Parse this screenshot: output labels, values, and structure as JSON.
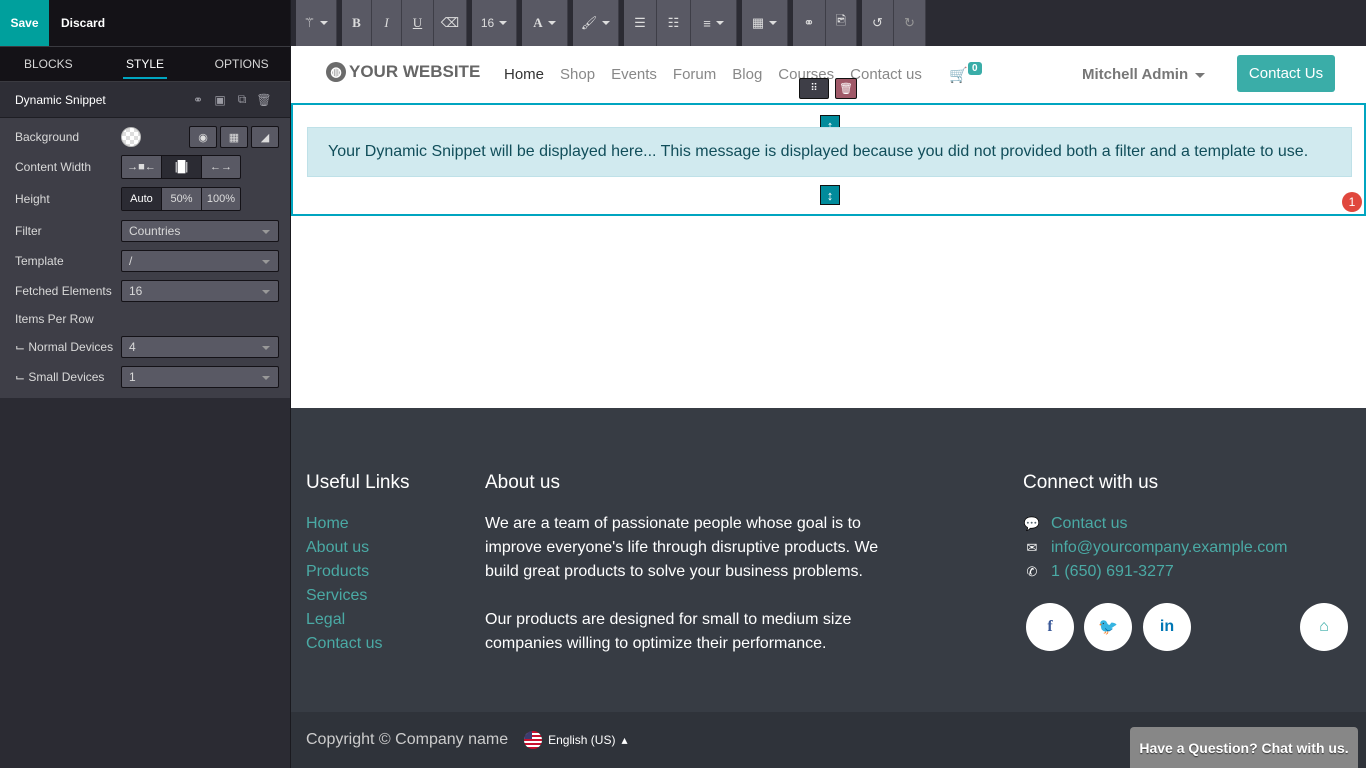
{
  "editor": {
    "save_label": "Save",
    "discard_label": "Discard",
    "tabs": [
      {
        "label": "BLOCKS"
      },
      {
        "label": "STYLE"
      },
      {
        "label": "OPTIONS"
      }
    ],
    "snippet_title": "Dynamic Snippet",
    "options": {
      "background_label": "Background",
      "content_width_label": "Content Width",
      "height_label": "Height",
      "height_options": [
        "Auto",
        "50%",
        "100%"
      ],
      "filter_label": "Filter",
      "filter_value": "Countries",
      "template_label": "Template",
      "template_value": "/",
      "fetched_label": "Fetched Elements",
      "fetched_value": "16",
      "items_per_row_label": "Items Per Row",
      "normal_devices_label": "⌙ Normal Devices",
      "normal_devices_value": "4",
      "small_devices_label": "⌙ Small Devices",
      "small_devices_value": "1"
    }
  },
  "toolbar": {
    "font_size": "16"
  },
  "site": {
    "logo": "YOUR WEBSITE",
    "nav": [
      "Home",
      "Shop",
      "Events",
      "Forum",
      "Blog",
      "Courses",
      "Contact us"
    ],
    "cart_count": "0",
    "user": "Mitchell Admin",
    "contact_button": "Contact Us",
    "snippet_message": "Your Dynamic Snippet will be displayed here... This message is displayed because you did not provided both a filter and a template to use.",
    "error_count": "1",
    "footer": {
      "useful_links_title": "Useful Links",
      "useful_links": [
        "Home",
        "About us",
        "Products",
        "Services",
        "Legal",
        "Contact us"
      ],
      "about_title": "About us",
      "about_p1": "We are a team of passionate people whose goal is to improve everyone's life through disruptive products. We build great products to solve your business problems.",
      "about_p2": "Our products are designed for small to medium size companies willing to optimize their performance.",
      "connect_title": "Connect with us",
      "contact_link": "Contact us",
      "email": "info@yourcompany.example.com",
      "phone": "1 (650) 691-3277"
    },
    "copyright": "Copyright © Company name",
    "language": "English (US)",
    "chat": "Have a Question? Chat with us."
  },
  "colors": {
    "accent": "#00a09d",
    "brand": "#3aada8",
    "selection": "#00a5c0"
  }
}
